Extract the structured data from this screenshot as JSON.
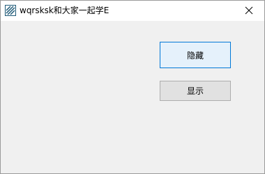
{
  "window": {
    "title": "wqrsksk和大家一起学E",
    "app_icon": "striped-app-icon",
    "close_icon": "close-icon"
  },
  "buttons": {
    "hide_label": "隐藏",
    "show_label": "显示"
  },
  "colors": {
    "client_bg": "#f0f0f0",
    "focused_button_bg": "#e5f1fb",
    "focused_button_border": "#0078d7",
    "button_bg": "#e1e1e1",
    "button_border": "#adadad",
    "icon_accent": "#1e5a78"
  }
}
